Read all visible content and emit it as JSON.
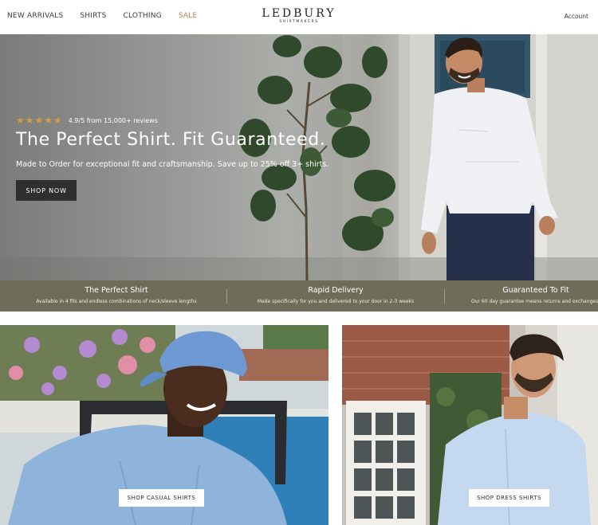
{
  "header": {
    "nav": [
      "NEW ARRIVALS",
      "SHIRTS",
      "CLOTHING",
      "SALE"
    ],
    "logo_name": "LEDBURY",
    "logo_sub": "SHIRTMAKERS",
    "account": "Account"
  },
  "hero": {
    "stars": "★★★★★",
    "rating_text": "4.9/5 from 15,000+ reviews",
    "headline": "The Perfect Shirt. Fit Guaranteed.",
    "subline": "Made to Order for exceptional fit and craftsmanship. Save up to 25% off 3+ shirts.",
    "cta": "SHOP NOW"
  },
  "benefits": [
    {
      "title": "The Perfect Shirt",
      "desc": "Available in 4 fits and endless combinations of neck/sleeve lengths"
    },
    {
      "title": "Rapid Delivery",
      "desc": "Made specifically for you and delivered to your door in 2-3 weeks"
    },
    {
      "title": "Guaranteed To Fit",
      "desc": "Our 60 day guarantee means returns and exchanges"
    }
  ],
  "tiles": {
    "casual": "SHOP CASUAL SHIRTS",
    "dress": "SHOP DRESS SHIRTS"
  },
  "colors": {
    "accent_sale": "#b9854c",
    "benefits_bar": "#6d6d58",
    "cta_bg": "#2f302c",
    "stars": "#d79a46"
  }
}
